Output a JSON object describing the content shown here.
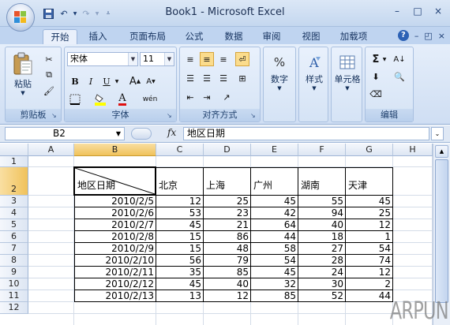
{
  "window": {
    "title": "Book1 - Microsoft Excel"
  },
  "title_controls": {
    "minimize": "–",
    "maximize": "□",
    "close": "×"
  },
  "quick_access": {
    "save": "save-icon",
    "undo": "undo-icon",
    "redo": "redo-icon",
    "customize": "customize-icon"
  },
  "tabs": [
    "开始",
    "插入",
    "页面布局",
    "公式",
    "数据",
    "审阅",
    "视图",
    "加载项"
  ],
  "active_tab": "开始",
  "ribbon": {
    "clipboard": {
      "label": "剪贴板",
      "paste": "粘贴"
    },
    "font": {
      "label": "字体",
      "name": "宋体",
      "size": "11"
    },
    "alignment": {
      "label": "对齐方式"
    },
    "number": {
      "label": "数字",
      "button": "数字",
      "icon": "%"
    },
    "styles": {
      "button": "样式"
    },
    "cells": {
      "button": "单元格"
    },
    "editing": {
      "label": "编辑"
    }
  },
  "formula_bar": {
    "name_box": "B2",
    "fx": "fx",
    "content": "地区日期"
  },
  "sheet": {
    "columns": [
      "A",
      "B",
      "C",
      "D",
      "E",
      "F",
      "G",
      "H"
    ],
    "rows": [
      "1",
      "2",
      "3",
      "4",
      "5",
      "6",
      "7",
      "8",
      "9",
      "10",
      "11",
      "12"
    ],
    "header_cell": "地区日期",
    "cities": [
      "北京",
      "上海",
      "广州",
      "湖南",
      "天津"
    ],
    "data": [
      {
        "date": "2010/2/5",
        "values": [
          "12",
          "25",
          "45",
          "55",
          "45"
        ]
      },
      {
        "date": "2010/2/6",
        "values": [
          "53",
          "23",
          "42",
          "94",
          "25"
        ]
      },
      {
        "date": "2010/2/7",
        "values": [
          "45",
          "21",
          "64",
          "40",
          "12"
        ]
      },
      {
        "date": "2010/2/8",
        "values": [
          "15",
          "86",
          "44",
          "18",
          "1"
        ]
      },
      {
        "date": "2010/2/9",
        "values": [
          "15",
          "48",
          "58",
          "27",
          "54"
        ]
      },
      {
        "date": "2010/2/10",
        "values": [
          "56",
          "79",
          "54",
          "28",
          "74"
        ]
      },
      {
        "date": "2010/2/11",
        "values": [
          "35",
          "85",
          "45",
          "24",
          "12"
        ]
      },
      {
        "date": "2010/2/12",
        "values": [
          "45",
          "40",
          "32",
          "30",
          "2"
        ]
      },
      {
        "date": "2010/2/13",
        "values": [
          "13",
          "12",
          "85",
          "52",
          "44"
        ]
      }
    ]
  },
  "watermark": "ARPUN",
  "colors": {
    "accent": "#f0c25b",
    "ribbon": "#dbe6f5"
  }
}
